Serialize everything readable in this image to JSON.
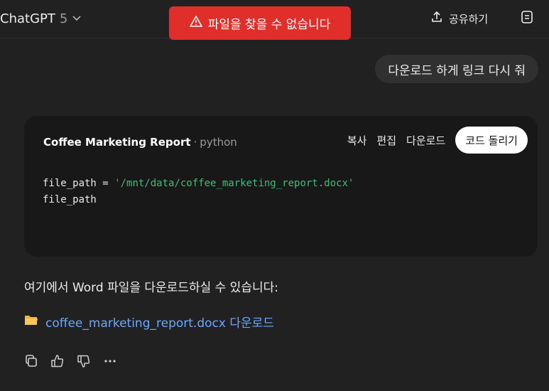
{
  "header": {
    "model_name": "ChatGPT",
    "model_version": "5",
    "share_label": "공유하기"
  },
  "toast": {
    "message": "파일을 찾을 수 없습니다",
    "color": "#e02e2a"
  },
  "user_message": "다운로드 하게 링크 다시 줘",
  "code_block": {
    "title": "Coffee Marketing Report",
    "separator": "·",
    "language": "python",
    "actions": {
      "copy": "복사",
      "edit": "편집",
      "download": "다운로드",
      "run": "코드 돌리기"
    },
    "line1_var": "file_path = ",
    "line1_str": "'/mnt/data/coffee_marketing_report.docx'",
    "line2": "file_path"
  },
  "assistant": {
    "text": "여기에서 Word 파일을 다운로드하실 수 있습니다:",
    "link_text": "coffee_marketing_report.docx 다운로드",
    "link_color": "#6ba7ff"
  },
  "icons": {
    "model_dropdown": "chevron-down-icon",
    "toast": "warning-triangle-icon",
    "share": "upload-icon",
    "notes": "notes-icon",
    "file": "folder-icon",
    "copy": "copy-icon",
    "like": "thumbs-up-icon",
    "dislike": "thumbs-down-icon",
    "more": "more-icon"
  }
}
